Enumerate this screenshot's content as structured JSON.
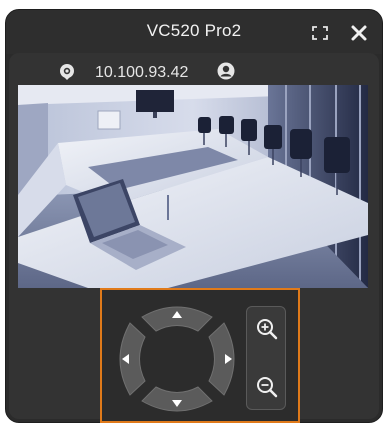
{
  "window": {
    "title": "VC520 Pro2"
  },
  "info": {
    "ip_address": "10.100.93.42"
  },
  "icons": {
    "fullscreen": "fullscreen-icon",
    "close": "close-icon",
    "location": "location-pin-icon",
    "user": "user-account-icon",
    "zoom_in": "zoom-in-icon",
    "zoom_out": "zoom-out-icon",
    "pan_up": "arrow-up-icon",
    "pan_down": "arrow-down-icon",
    "pan_left": "arrow-left-icon",
    "pan_right": "arrow-right-icon"
  },
  "colors": {
    "window_bg": "#2b2b2b",
    "panel_bg": "#333333",
    "highlight_border": "#e07a1a",
    "button_fill": "#5b5b5b",
    "text": "#f2f2f2"
  }
}
